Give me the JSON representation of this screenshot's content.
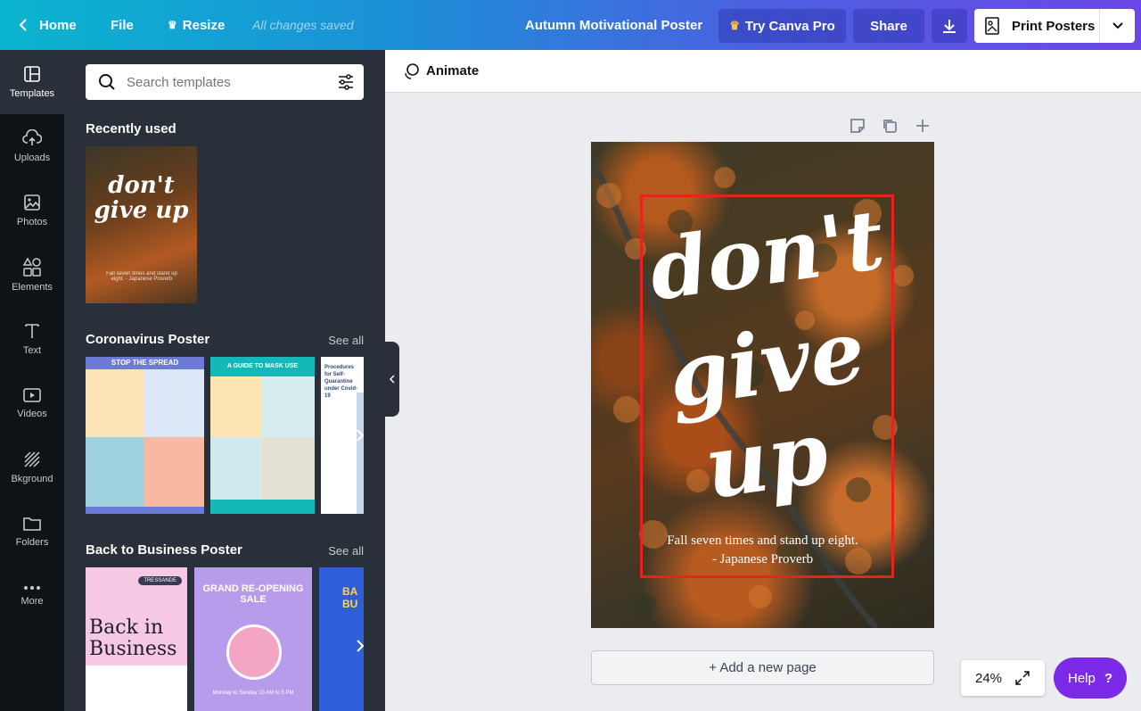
{
  "topbar": {
    "home": "Home",
    "file": "File",
    "resize": "Resize",
    "saved_status": "All changes saved",
    "doc_title": "Autumn Motivational Poster",
    "try_pro": "Try Canva Pro",
    "share": "Share",
    "print": "Print Posters"
  },
  "nav": [
    {
      "label": "Templates",
      "icon": "templates-icon"
    },
    {
      "label": "Uploads",
      "icon": "upload-icon"
    },
    {
      "label": "Photos",
      "icon": "image-icon"
    },
    {
      "label": "Elements",
      "icon": "shapes-icon"
    },
    {
      "label": "Text",
      "icon": "text-icon"
    },
    {
      "label": "Videos",
      "icon": "video-icon"
    },
    {
      "label": "Bkground",
      "icon": "background-icon"
    },
    {
      "label": "Folders",
      "icon": "folder-icon"
    },
    {
      "label": "More",
      "icon": "more-icon"
    }
  ],
  "panel": {
    "search_placeholder": "Search templates",
    "recently_used": "Recently used",
    "recent_thumb": {
      "script": "don't give up",
      "caption": "Fall seven times and stand up eight. - Japanese Proverb"
    },
    "sections": [
      {
        "title": "Coronavirus Poster",
        "see_all": "See all",
        "thumbs": [
          {
            "heading": "STOP THE SPREAD",
            "color": "#6d7bd8"
          },
          {
            "heading": "A GUIDE TO MASK USE",
            "color": "#15b8b8"
          },
          {
            "heading": "Procedures for Self-Quarantine under Covid-19",
            "color": "#ffffff"
          }
        ]
      },
      {
        "title": "Back to Business Poster",
        "see_all": "See all",
        "thumbs": [
          {
            "heading": "Back in Business",
            "tag": "TRESSANDE",
            "color": "#f6c8e6"
          },
          {
            "heading": "GRAND RE-OPENING SALE",
            "tag": "Monday to Sunday 10 AM to 5 PM",
            "color": "#b89cec"
          },
          {
            "heading": "BA BU",
            "color": "#2f5fd8"
          }
        ]
      }
    ]
  },
  "editor": {
    "animate": "Animate",
    "poster": {
      "script_lines": [
        "don't",
        "give",
        "up"
      ],
      "quote_line1": "Fall seven times and stand up eight.",
      "quote_line2": "- Japanese Proverb"
    },
    "add_page": "+ Add a new page",
    "zoom": "24%",
    "help": "Help",
    "help_symbol": "?"
  },
  "colors": {
    "accent_purple": "#7d2ae8",
    "selection_red": "#e8221c",
    "panel_dark": "#293039",
    "nav_dark": "#0e1318"
  }
}
